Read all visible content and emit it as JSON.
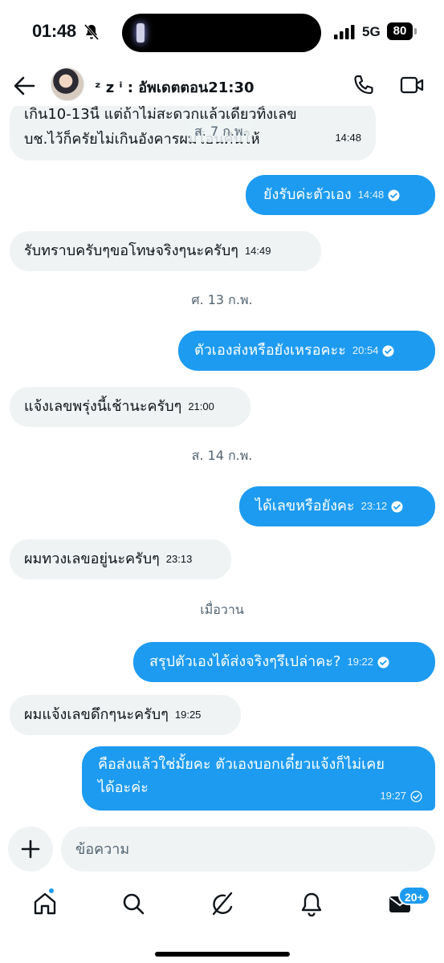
{
  "status_bar": {
    "time": "01:48",
    "network": "5G",
    "battery": "80"
  },
  "header": {
    "contact_name": "ᶻ z ⁱ : อัพเดตตอน21:30"
  },
  "chat": {
    "sticky_date": "ส. 7 ก.พ.",
    "messages": [
      {
        "dir": "in",
        "lines": [
          "เกิน10-13นี้ แต่ถ้าไม่สะดวกแล้วเดี๋ยวทิ้งเลข",
          "บช.ไว้ก็ครัยไม่เกินอังคารผมโอนคืนให้"
        ],
        "time": "14:48"
      },
      {
        "dir": "out",
        "lines": [
          "ยังรับค่ะตัวเอง"
        ],
        "time": "14:48"
      },
      {
        "dir": "in",
        "lines": [
          "รับทราบครับๆขอโทษจริงๆนะครับๆ"
        ],
        "time": "14:49"
      },
      {
        "dir": "out",
        "lines": [
          "ตัวเองส่งหรือยังเหรอคะะ"
        ],
        "time": "20:54"
      },
      {
        "dir": "in",
        "lines": [
          "แจ้งเลขพรุ่งนี้เช้านะครับๆ"
        ],
        "time": "21:00"
      },
      {
        "dir": "out",
        "lines": [
          "ได้เลขหรือยังคะ"
        ],
        "time": "23:12"
      },
      {
        "dir": "in",
        "lines": [
          "ผมทวงเลขอยู่นะครับๆ"
        ],
        "time": "23:13"
      },
      {
        "dir": "out",
        "lines": [
          "สรุปตัวเองได้ส่งจริงๆรึเปล่าคะ?"
        ],
        "time": "19:22"
      },
      {
        "dir": "in",
        "lines": [
          "ผมแจ้งเลขดึกๆนะครับๆ"
        ],
        "time": "19:25"
      },
      {
        "dir": "out",
        "lines": [
          "คือส่งแล้วใช่มั้ยคะ ตัวเองบอกเดี๋ยวแจ้งก็ไม่เคย",
          "ได้อะค่ะ"
        ],
        "time": "19:27"
      }
    ],
    "date_separators": [
      "ศ. 13 ก.พ.",
      "ส. 14 ก.พ.",
      "เมื่อวาน"
    ]
  },
  "composer": {
    "placeholder": "ข้อความ"
  },
  "tabbar": {
    "messages_badge": "20+"
  },
  "colors": {
    "accent": "#1d9bf0",
    "incoming_bubble": "#eff3f4",
    "text": "#0f1419",
    "muted": "#536471"
  },
  "icons": [
    "back-arrow-icon",
    "phone-icon",
    "video-icon",
    "plus-icon",
    "home-icon",
    "search-icon",
    "grok-icon",
    "bell-icon",
    "mail-icon",
    "bell-off-icon",
    "signal-icon",
    "seen-check-icon"
  ]
}
